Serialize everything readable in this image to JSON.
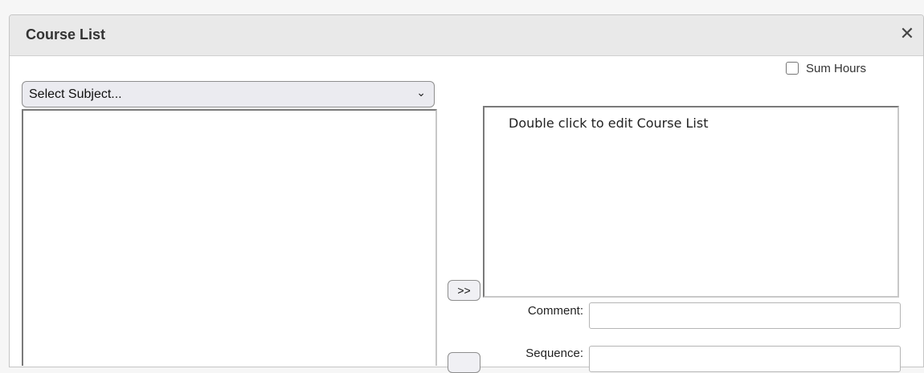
{
  "dialog": {
    "title": "Course List",
    "close_icon": "close-icon"
  },
  "sum_hours": {
    "label": "Sum Hours",
    "checked": false
  },
  "subject_select": {
    "value": "Select Subject...",
    "chevron": "⌄"
  },
  "selected_list": {
    "placeholder": "Double click to edit Course List"
  },
  "buttons": {
    "add_label": ">>",
    "remove_label": ""
  },
  "fields": {
    "comment_label": "Comment:",
    "comment_value": "",
    "sequence_label": "Sequence:",
    "sequence_value": ""
  }
}
